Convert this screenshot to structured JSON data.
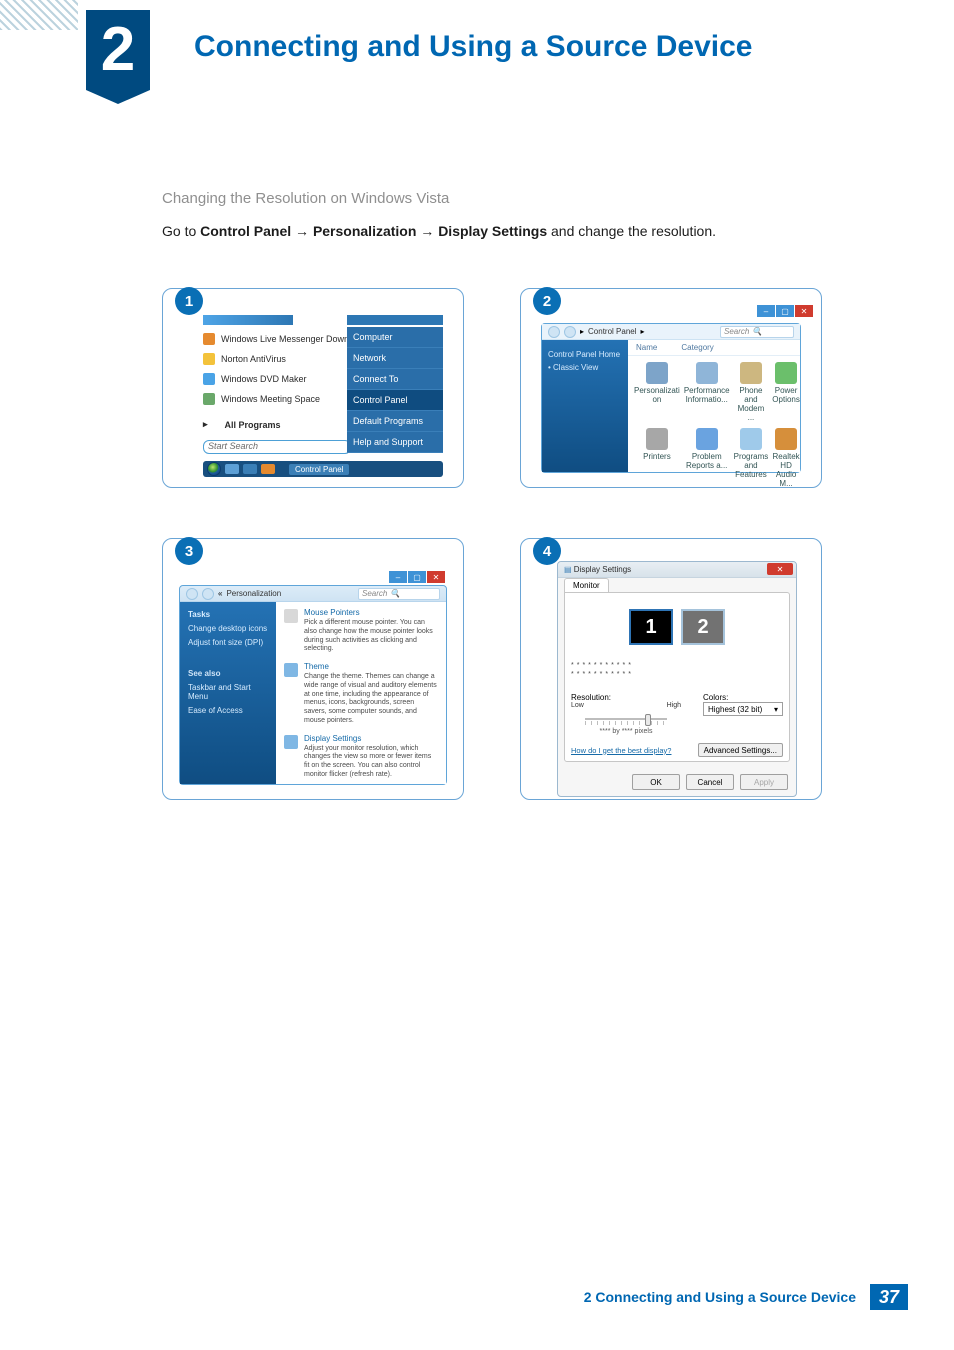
{
  "chapter": {
    "number": "2",
    "title": "Connecting and Using a Source Device"
  },
  "section": {
    "subtitle": "Changing the Resolution on Windows Vista",
    "instruction_prefix": "Go to ",
    "path": [
      "Control Panel",
      "Personalization",
      "Display Settings"
    ],
    "arrow": " → ",
    "instruction_suffix": " and change the resolution."
  },
  "steps": [
    "1",
    "2",
    "3",
    "4"
  ],
  "shot1": {
    "programs": [
      {
        "label": "Windows Live Messenger Download",
        "color": "#e58a2f"
      },
      {
        "label": "Norton AntiVirus",
        "color": "#f3c23b"
      },
      {
        "label": "Windows DVD Maker",
        "color": "#4aa3e6"
      },
      {
        "label": "Windows Meeting Space",
        "color": "#6aa86a"
      }
    ],
    "all_programs": "All Programs",
    "search_placeholder": "Start Search",
    "right_menu": [
      "Computer",
      "Network",
      "Connect To",
      "Control Panel",
      "Default Programs",
      "Help and Support"
    ],
    "right_selected": "Control Panel",
    "taskbar_label": "Control Panel"
  },
  "shot2": {
    "breadcrumb": "Control Panel",
    "search_placeholder": "Search",
    "side_links": [
      "Control Panel Home",
      "Classic View"
    ],
    "cols": [
      "Name",
      "Category"
    ],
    "icons": [
      {
        "label": "Personalizati on",
        "color": "#7da4c9"
      },
      {
        "label": "Performance Informatio...",
        "color": "#8fb5d8"
      },
      {
        "label": "Phone and Modem ...",
        "color": "#cdb780"
      },
      {
        "label": "Power Options",
        "color": "#6bbf6b"
      },
      {
        "label": "Printers",
        "color": "#a7a7a7"
      },
      {
        "label": "Problem Reports a...",
        "color": "#6aa3e0"
      },
      {
        "label": "Programs and Features",
        "color": "#9fcaea"
      },
      {
        "label": "Realtek HD Audio M...",
        "color": "#d68f3b"
      }
    ]
  },
  "shot3": {
    "breadcrumb": "Personalization",
    "search_placeholder": "Search",
    "tasks_label": "Tasks",
    "task_links": [
      "Change desktop icons",
      "Adjust font size (DPI)"
    ],
    "seealso_label": "See also",
    "seealso_links": [
      "Taskbar and Start Menu",
      "Ease of Access"
    ],
    "sections": [
      {
        "title": "Mouse Pointers",
        "desc": "Pick a different mouse pointer. You can also change how the mouse pointer looks during such activities as clicking and selecting."
      },
      {
        "title": "Theme",
        "desc": "Change the theme. Themes can change a wide range of visual and auditory elements at one time, including the appearance of menus, icons, backgrounds, screen savers, some computer sounds, and mouse pointers."
      },
      {
        "title": "Display Settings",
        "desc": "Adjust your monitor resolution, which changes the view so more or fewer items fit on the screen. You can also control monitor flicker (refresh rate)."
      }
    ]
  },
  "shot4": {
    "title": "Display Settings",
    "tab": "Monitor",
    "monitors": [
      "1",
      "2"
    ],
    "stars": "***********",
    "resolution_label": "Resolution:",
    "low": "Low",
    "high": "High",
    "px_line": "**** by **** pixels",
    "colors_label": "Colors:",
    "colors_value": "Highest (32 bit)",
    "help_link": "How do I get the best display?",
    "advanced_btn": "Advanced Settings...",
    "buttons": [
      "OK",
      "Cancel",
      "Apply"
    ]
  },
  "footer": {
    "text": "2 Connecting and Using a Source Device",
    "page": "37"
  }
}
